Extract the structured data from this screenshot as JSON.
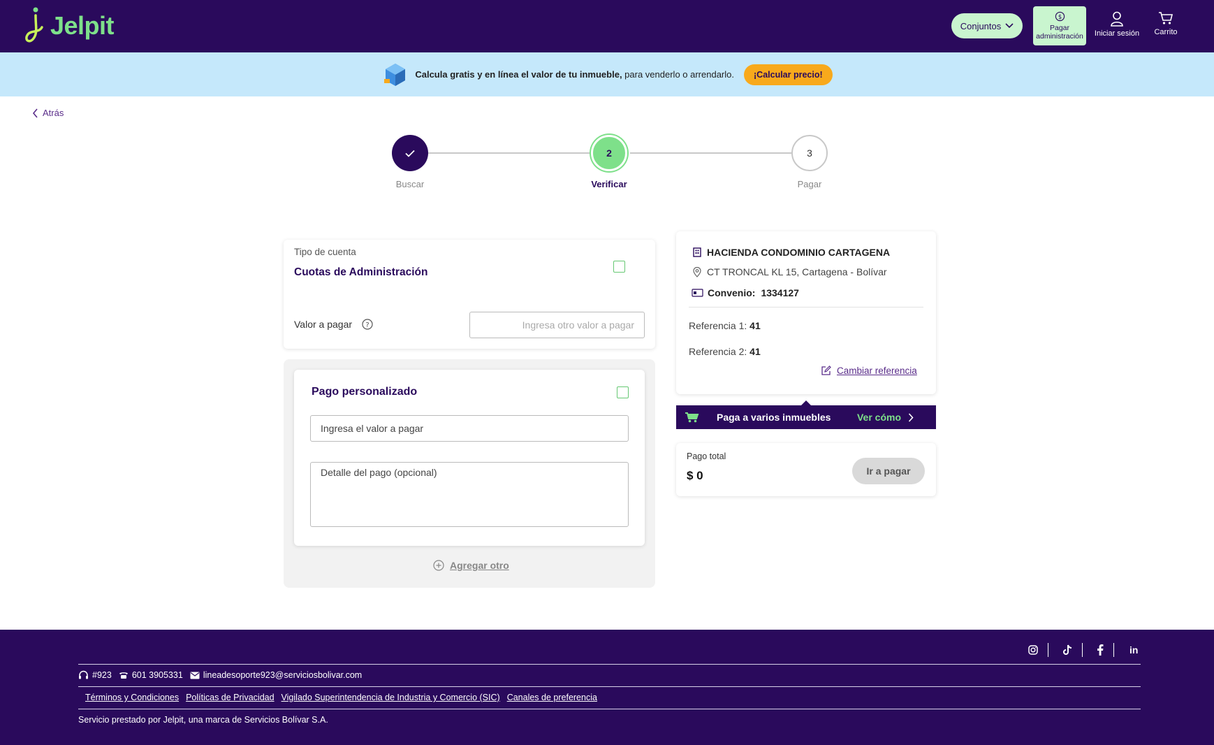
{
  "header": {
    "logo_text": "Jelpit",
    "conjuntos_label": "Conjuntos",
    "pagar_admin_line1": "Pagar",
    "pagar_admin_line2": "administración",
    "login_label": "Iniciar sesión",
    "cart_label": "Carrito"
  },
  "banner": {
    "bold_text": "Calcula gratis y en línea el valor de tu inmueble,",
    "text": " para venderlo o arrendarlo.",
    "button_label": "¡Calcular precio!"
  },
  "back_label": "Atrás",
  "stepper": {
    "steps": [
      {
        "number": "✓",
        "label": "Buscar",
        "state": "done"
      },
      {
        "number": "2",
        "label": "Verificar",
        "state": "active"
      },
      {
        "number": "3",
        "label": "Pagar",
        "state": "pending"
      }
    ]
  },
  "tipo_cuenta": {
    "label": "Tipo de cuenta",
    "value": "Cuotas de Administración",
    "valor_label": "Valor a pagar",
    "valor_placeholder": "Ingresa otro valor a pagar"
  },
  "pago_personalizado": {
    "title": "Pago personalizado",
    "valor_placeholder": "Ingresa el valor a pagar",
    "detalle_placeholder": "Detalle del pago (opcional)",
    "agregar_label": "Agregar otro"
  },
  "inmueble": {
    "name": "HACIENDA CONDOMINIO CARTAGENA",
    "address": "CT TRONCAL KL 15, Cartagena - Bolívar",
    "convenio_label": "Convenio:",
    "convenio_value": "1334127",
    "ref1_label": "Referencia 1:",
    "ref1_value": "41",
    "ref2_label": "Referencia 2:",
    "ref2_value": "41",
    "cambiar_label": "Cambiar referencia"
  },
  "varios": {
    "label": "Paga a varios inmuebles",
    "link": "Ver cómo"
  },
  "total": {
    "label": "Pago total",
    "value": "$ 0",
    "button_label": "Ir a pagar"
  },
  "footer": {
    "phone_short": "#923",
    "phone": "601 3905331",
    "email": "lineadesoporte923@serviciosbolivar.com",
    "links": [
      "Términos y Condiciones",
      "Políticas de Privacidad",
      "Vigilado Superintendencia de Industria y Comercio (SIC)",
      "Canales de preferencia"
    ],
    "legal": "Servicio prestado por Jelpit, una marca de Servicios Bolívar S.A."
  },
  "colors": {
    "brand_purple": "#2a0a5c",
    "brand_green": "#7ee08a",
    "banner_blue": "#c5e8fb",
    "accent_orange": "#f8a91c"
  }
}
